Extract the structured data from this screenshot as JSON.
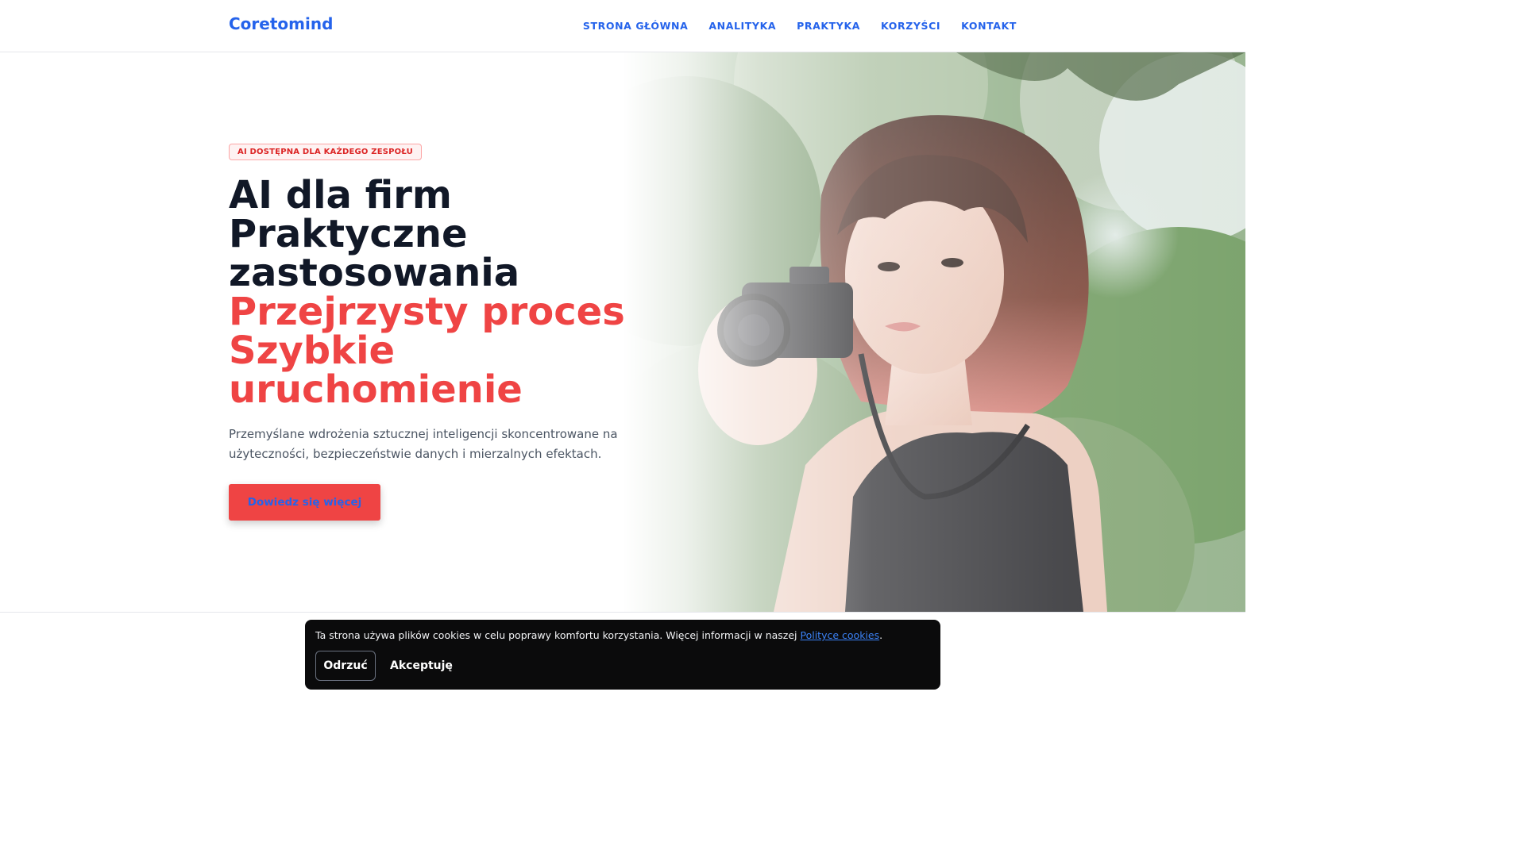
{
  "header": {
    "logo": "Coretomind",
    "nav": [
      "STRONA GŁÓWNA",
      "ANALITYKA",
      "PRAKTYKA",
      "KORZYŚCI",
      "KONTAKT"
    ]
  },
  "hero": {
    "badge": "AI DOSTĘPNA DLA KAŻDEGO ZESPOŁU",
    "headline_dark": [
      "AI dla firm",
      "Praktyczne zastosowania"
    ],
    "headline_red": [
      "Przejrzysty proces",
      "Szybkie uruchomienie"
    ],
    "lead": "Przemyślane wdrożenia sztucznej inteligencji skoncentrowane na użyteczności, bezpieczeństwie danych i mierzalnych efektach.",
    "cta_label": "Dowiedz się więcej"
  },
  "cookie": {
    "text": "Ta strona używa plików cookies w celu poprawy komfortu korzystania. Więcej informacji w naszej ",
    "link": "Polityce cookies",
    "suffix": ".",
    "reject_label": "Odrzuć",
    "accept_label": "Akceptuję"
  },
  "colors": {
    "brand": "#2563eb",
    "accent": "#ef4444",
    "dark": "#111827"
  }
}
